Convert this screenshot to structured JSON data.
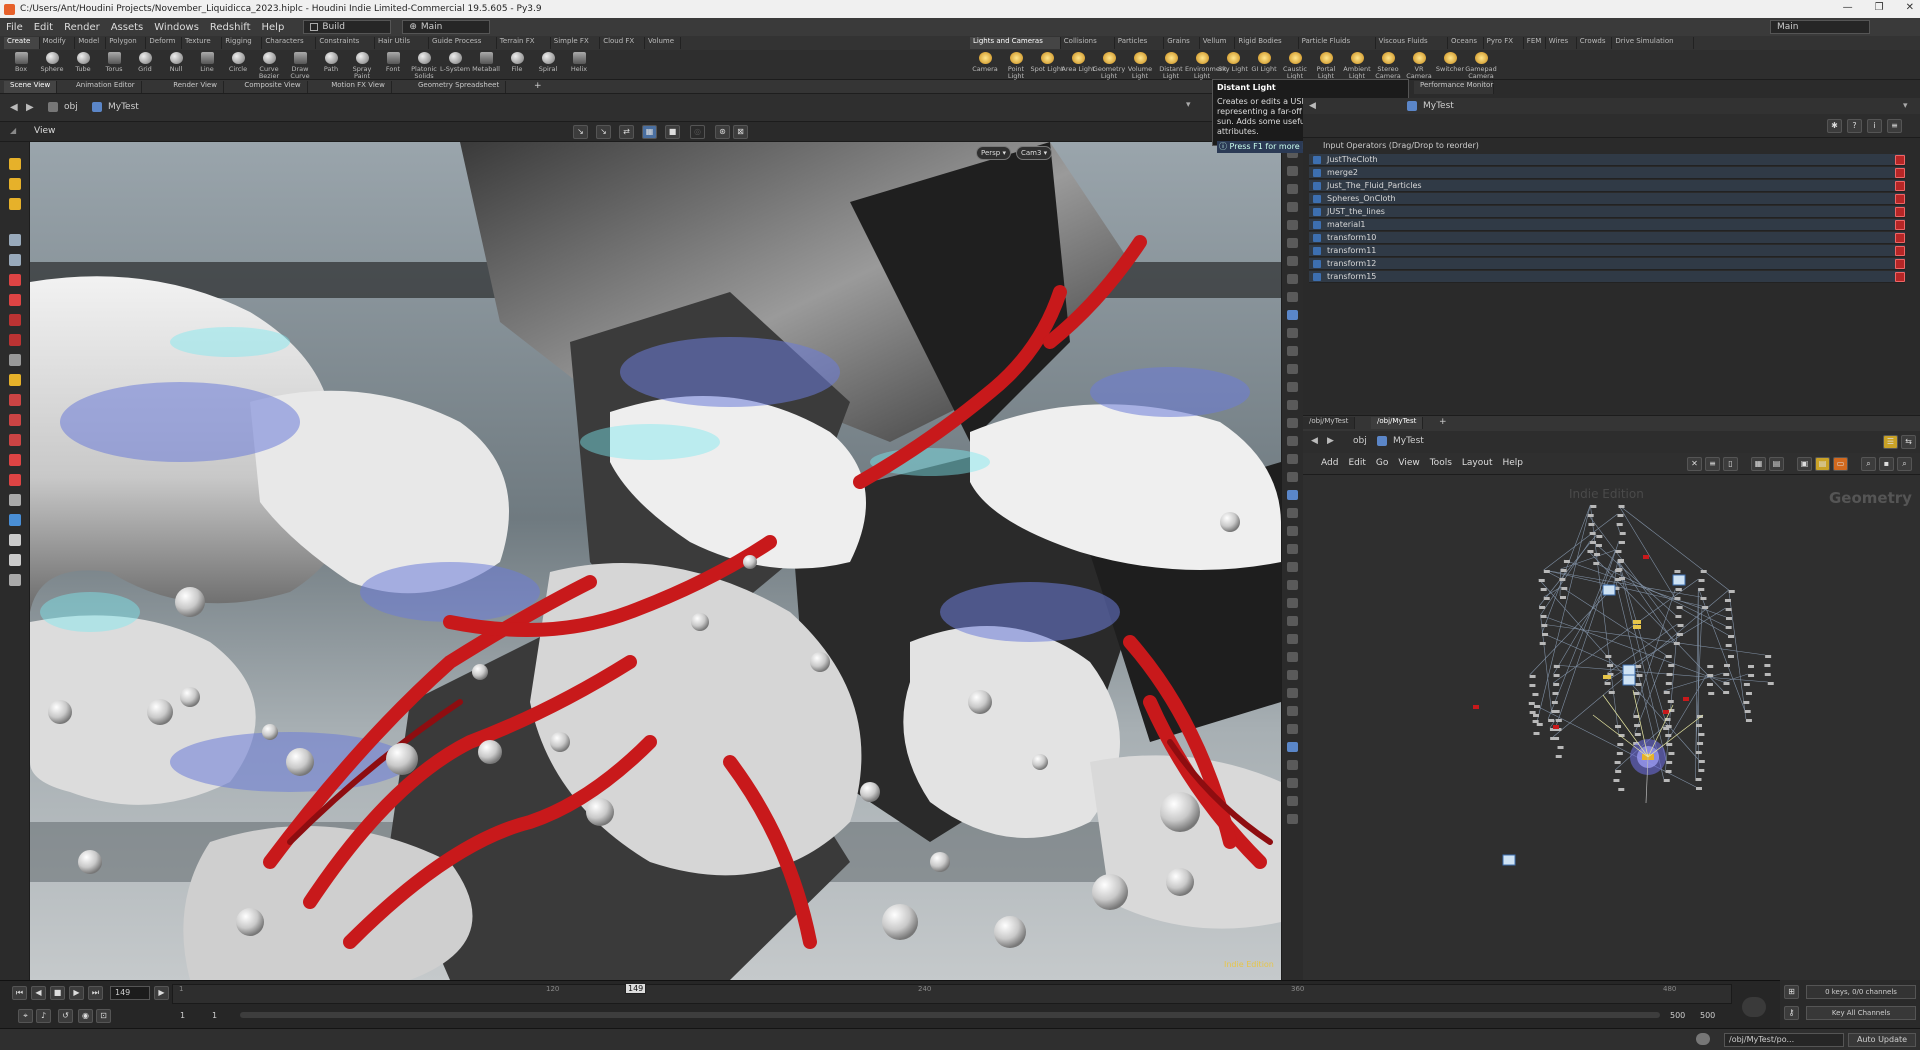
{
  "window": {
    "title": "C:/Users/Ant/Houdini Projects/November_Liquidicca_2023.hiplc - Houdini Indie Limited-Commercial 19.5.605 - Py3.9",
    "controls": [
      "—",
      "❐",
      "✕"
    ]
  },
  "menu": {
    "items": [
      "File",
      "Edit",
      "Render",
      "Assets",
      "Windows",
      "Redshift",
      "Help"
    ],
    "desktop": "Build",
    "context": "Main",
    "right_desktop": "Main"
  },
  "shelf_tabs_left": [
    "Create",
    "Modify",
    "Model",
    "Polygon",
    "Deform",
    "Texture",
    "Rigging",
    "Characters",
    "Constraints",
    "Hair Utils",
    "Guide Process",
    "Terrain FX",
    "Simple FX",
    "Cloud FX",
    "Volume"
  ],
  "shelf_tabs_right": [
    "Lights and Cameras",
    "Collisions",
    "Particles",
    "Grains",
    "Vellum",
    "Rigid Bodies",
    "Particle Fluids",
    "Viscous Fluids",
    "Oceans",
    "Pyro FX",
    "FEM",
    "Wires",
    "Crowds",
    "Drive Simulation"
  ],
  "tools_left": [
    "Box",
    "Sphere",
    "Tube",
    "Torus",
    "Grid",
    "Null",
    "Line",
    "Circle",
    "Curve Bezier",
    "Draw Curve",
    "Path",
    "Spray Paint",
    "Font",
    "Platonic Solids",
    "L-System",
    "Metaball",
    "File",
    "Spiral",
    "Helix"
  ],
  "tools_right": [
    "Camera",
    "Point Light",
    "Spot Light",
    "Area Light",
    "Geometry Light",
    "Volume Light",
    "Distant Light",
    "Environment Light",
    "Sky Light",
    "GI Light",
    "Caustic Light",
    "Portal Light",
    "Ambient Light",
    "Stereo Camera",
    "VR Camera",
    "Switcher",
    "Gamepad Camera"
  ],
  "pane_tabs": [
    "Scene View",
    "Animation Editor",
    "Render View",
    "Composite View",
    "Motion FX View",
    "Geometry Spreadsheet"
  ],
  "right_pane_tab": "Performance Monitor",
  "path": {
    "obj": "obj",
    "node": "MyTest"
  },
  "viewport": {
    "label": "View",
    "persp": "Persp ▾",
    "cam": "Cam3 ▾",
    "watermark": "Indie Edition"
  },
  "tooltip": {
    "title": "Distant Light",
    "body": "Creates or edits a USD Distant Light, representing a far-off light source such as the sun. Adds some useful Karma-specific attributes.",
    "help": "Press F1 for more help."
  },
  "params": {
    "header": "Input Operators (Drag/Drop to reorder)",
    "inputs": [
      "JustTheCloth",
      "merge2",
      "Just_The_Fluid_Particles",
      "Spheres_OnCloth",
      "JUST_the_lines",
      "material1",
      "transform10",
      "transform11",
      "transform12",
      "transform15"
    ]
  },
  "network": {
    "tabs": [
      "/obj/MyTest",
      "/obj/MyTest"
    ],
    "path_obj": "obj",
    "path_node": "MyTest",
    "menu": [
      "Add",
      "Edit",
      "Go",
      "View",
      "Tools",
      "Layout",
      "Help"
    ],
    "indie": "Indie Edition",
    "context_label": "Geometry"
  },
  "timeline": {
    "frame": "149",
    "playhead": "149",
    "ticks": [
      "1",
      "120",
      "240",
      "360",
      "480"
    ],
    "start": "1",
    "start2": "1",
    "end": "500",
    "end2": "500"
  },
  "keys": {
    "status": "0 keys, 0/0 channels",
    "button": "Key All Channels"
  },
  "status": {
    "path": "/obj/MyTest/po...",
    "update": "Auto Update"
  },
  "colors": {
    "accent_red": "#c8191b",
    "houdini_orange": "#e6602a",
    "selection_blue": "#3d6fb0"
  }
}
